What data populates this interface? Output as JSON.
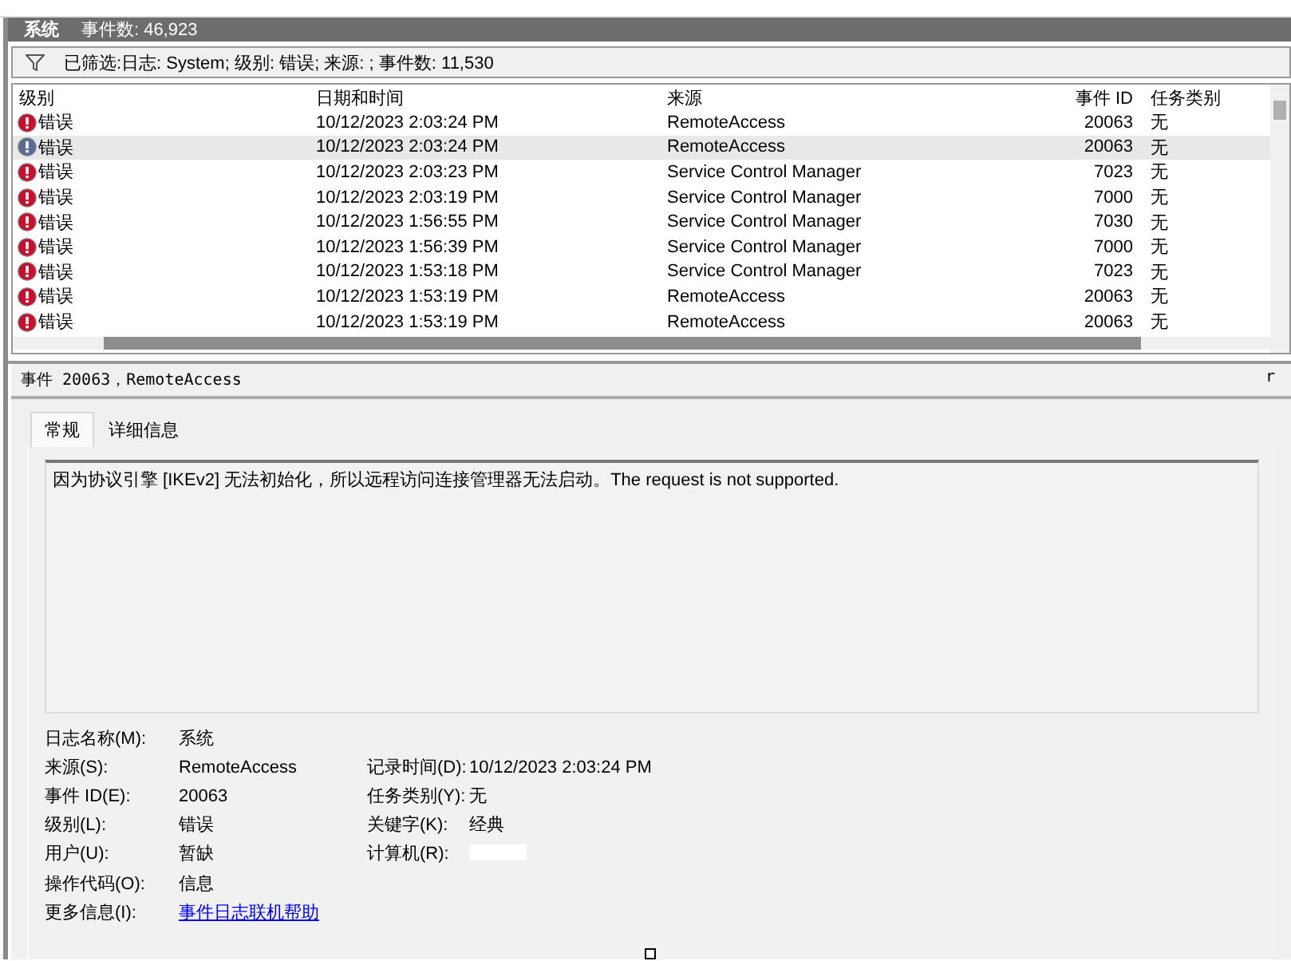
{
  "log_header": {
    "title": "系统",
    "count": "事件数: 46,923"
  },
  "filter_bar": {
    "text": "已筛选:日志: System; 级别: 错误; 来源: ; 事件数: 11,530"
  },
  "table": {
    "columns": [
      "级别",
      "日期和时间",
      "来源",
      "事件 ID",
      "任务类别"
    ],
    "rows": [
      {
        "level": "错误",
        "datetime": "10/12/2023 2:03:24 PM",
        "source": "RemoteAccess",
        "event_id": "20063",
        "task": "无",
        "selected": false
      },
      {
        "level": "错误",
        "datetime": "10/12/2023 2:03:24 PM",
        "source": "RemoteAccess",
        "event_id": "20063",
        "task": "无",
        "selected": true
      },
      {
        "level": "错误",
        "datetime": "10/12/2023 2:03:23 PM",
        "source": "Service Control Manager",
        "event_id": "7023",
        "task": "无",
        "selected": false
      },
      {
        "level": "错误",
        "datetime": "10/12/2023 2:03:19 PM",
        "source": "Service Control Manager",
        "event_id": "7000",
        "task": "无",
        "selected": false
      },
      {
        "level": "错误",
        "datetime": "10/12/2023 1:56:55 PM",
        "source": "Service Control Manager",
        "event_id": "7030",
        "task": "无",
        "selected": false
      },
      {
        "level": "错误",
        "datetime": "10/12/2023 1:56:39 PM",
        "source": "Service Control Manager",
        "event_id": "7000",
        "task": "无",
        "selected": false
      },
      {
        "level": "错误",
        "datetime": "10/12/2023 1:53:18 PM",
        "source": "Service Control Manager",
        "event_id": "7023",
        "task": "无",
        "selected": false
      },
      {
        "level": "错误",
        "datetime": "10/12/2023 1:53:19 PM",
        "source": "RemoteAccess",
        "event_id": "20063",
        "task": "无",
        "selected": false
      },
      {
        "level": "错误",
        "datetime": "10/12/2023 1:53:19 PM",
        "source": "RemoteAccess",
        "event_id": "20063",
        "task": "无",
        "selected": false
      }
    ]
  },
  "detail": {
    "title": "事件 20063，RemoteAccess",
    "close_glyph": "r",
    "tabs": [
      {
        "label": "常规",
        "selected": true
      },
      {
        "label": "详细信息",
        "selected": false
      }
    ],
    "description": "因为协议引擎 [IKEv2] 无法初始化，所以远程访问连接管理器无法启动。The request is not supported.",
    "properties": [
      {
        "label": "日志名称(M):",
        "value": "系统"
      },
      {
        "label": "来源(S):",
        "value": "RemoteAccess",
        "label2": "记录时间(D):",
        "value2": "10/12/2023 2:03:24 PM"
      },
      {
        "label": "事件 ID(E):",
        "value": "20063",
        "label2": "任务类别(Y):",
        "value2": "无"
      },
      {
        "label": "级别(L):",
        "value": "错误",
        "label2": "关键字(K):",
        "value2": "经典"
      },
      {
        "label": "用户(U):",
        "value": "暂缺",
        "label2": "计算机(R):",
        "redacted": true
      },
      {
        "label": "操作代码(O):",
        "value": "信息"
      },
      {
        "label": "更多信息(I):",
        "value": "事件日志联机帮助",
        "kind": "link"
      }
    ]
  }
}
